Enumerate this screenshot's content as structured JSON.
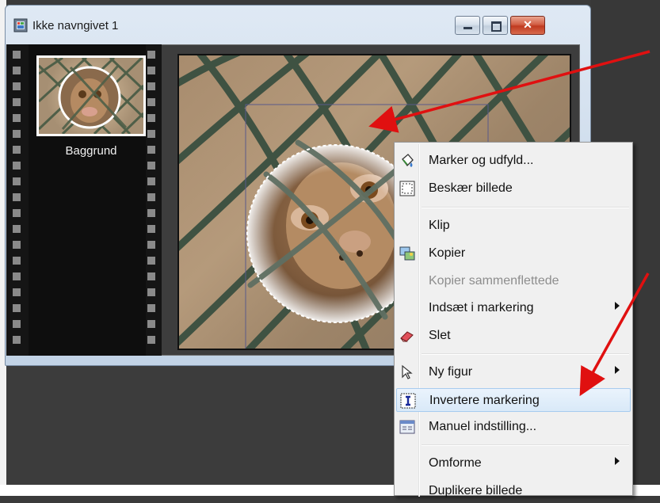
{
  "window": {
    "title": "Ikke navngivet 1",
    "icon": "film-icon"
  },
  "filmstrip": {
    "layer_label": "Baggrund"
  },
  "context_menu": {
    "items": [
      {
        "label": "Marker og udfyld...",
        "icon": "bucket-fill-icon"
      },
      {
        "label": "Beskær billede",
        "icon": "crop-icon"
      },
      {
        "label": "Klip"
      },
      {
        "label": "Kopier",
        "icon": "copy-picture-icon"
      },
      {
        "label": "Kopier sammenflettede",
        "disabled": true
      },
      {
        "label": "Indsæt i markering",
        "submenu": true
      },
      {
        "label": "Slet",
        "icon": "eraser-icon"
      },
      {
        "label": "Ny figur",
        "icon": "cursor-arrow-icon",
        "submenu": true
      },
      {
        "label": "Invertere markering",
        "icon": "invert-selection-icon",
        "highlighted": true
      },
      {
        "label": "Manuel indstilling...",
        "icon": "dialog-window-icon"
      },
      {
        "label": "Omforme",
        "submenu": true
      },
      {
        "label": "Duplikere billede"
      }
    ]
  },
  "colors": {
    "accent_arrow": "#e01010",
    "menu_highlight": "#d9e9f8",
    "close_button": "#c03a20"
  }
}
